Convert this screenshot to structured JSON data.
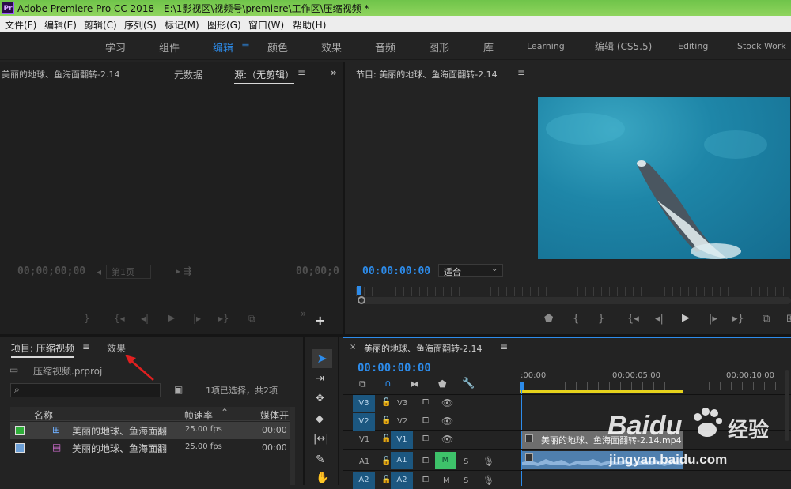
{
  "app": {
    "title": "Adobe Premiere Pro CC 2018 - E:\\1影视区\\视频号\\premiere\\工作区\\压缩视频 *",
    "logo": "Pr"
  },
  "menu": [
    "文件(F)",
    "编辑(E)",
    "剪辑(C)",
    "序列(S)",
    "标记(M)",
    "图形(G)",
    "窗口(W)",
    "帮助(H)"
  ],
  "workspaces": [
    "学习",
    "组件",
    "编辑",
    "颜色",
    "效果",
    "音频",
    "图形",
    "库",
    "Learning",
    "编辑 (CS5.5)",
    "Editing",
    "Stock Work"
  ],
  "source_panel": {
    "tab1": "美丽的地球、鱼海面翻转-2.14",
    "tab2": "元数据",
    "tab3": "源:（无剪辑）",
    "timecode_left": "00;00;00;00",
    "page": "第1页",
    "timecode_right": "00;00;0"
  },
  "program_panel": {
    "title": "节目: 美丽的地球、鱼海面翻转-2.14",
    "timecode": "00:00:00:00",
    "fit": "适合"
  },
  "project_panel": {
    "tab_project": "项目: 压缩视频",
    "tab_effects": "效果",
    "file": "压缩视频.prproj",
    "selection": "1项已选择，共2项",
    "col_name": "名称",
    "col_fps": "帧速率",
    "col_media": "媒体开",
    "items": [
      {
        "name": "美丽的地球、鱼海面翻",
        "fps": "25.00 fps",
        "start": "00:00",
        "color": "#2fae3a"
      },
      {
        "name": "美丽的地球、鱼海面翻",
        "fps": "25.00 fps",
        "start": "00:00",
        "color": "#6c9fd6"
      }
    ]
  },
  "timeline": {
    "title": "美丽的地球、鱼海面翻转-2.14",
    "timecode": "00:00:00:00",
    "ruler": [
      ":00:00",
      "00:00:05:00",
      "00:00:10:00"
    ],
    "tracks": [
      "V3",
      "V2",
      "V1",
      "A1",
      "A2"
    ],
    "video_clip": "美丽的地球、鱼海面翻转-2.14.mp4"
  },
  "watermark": {
    "brand": "Baidu",
    "jingyan": "经验",
    "url": "jingyan.baidu.com"
  },
  "colors": {
    "accent": "#2d8ceb",
    "titlebar": "#7ccc52",
    "track": "#1c5780"
  }
}
